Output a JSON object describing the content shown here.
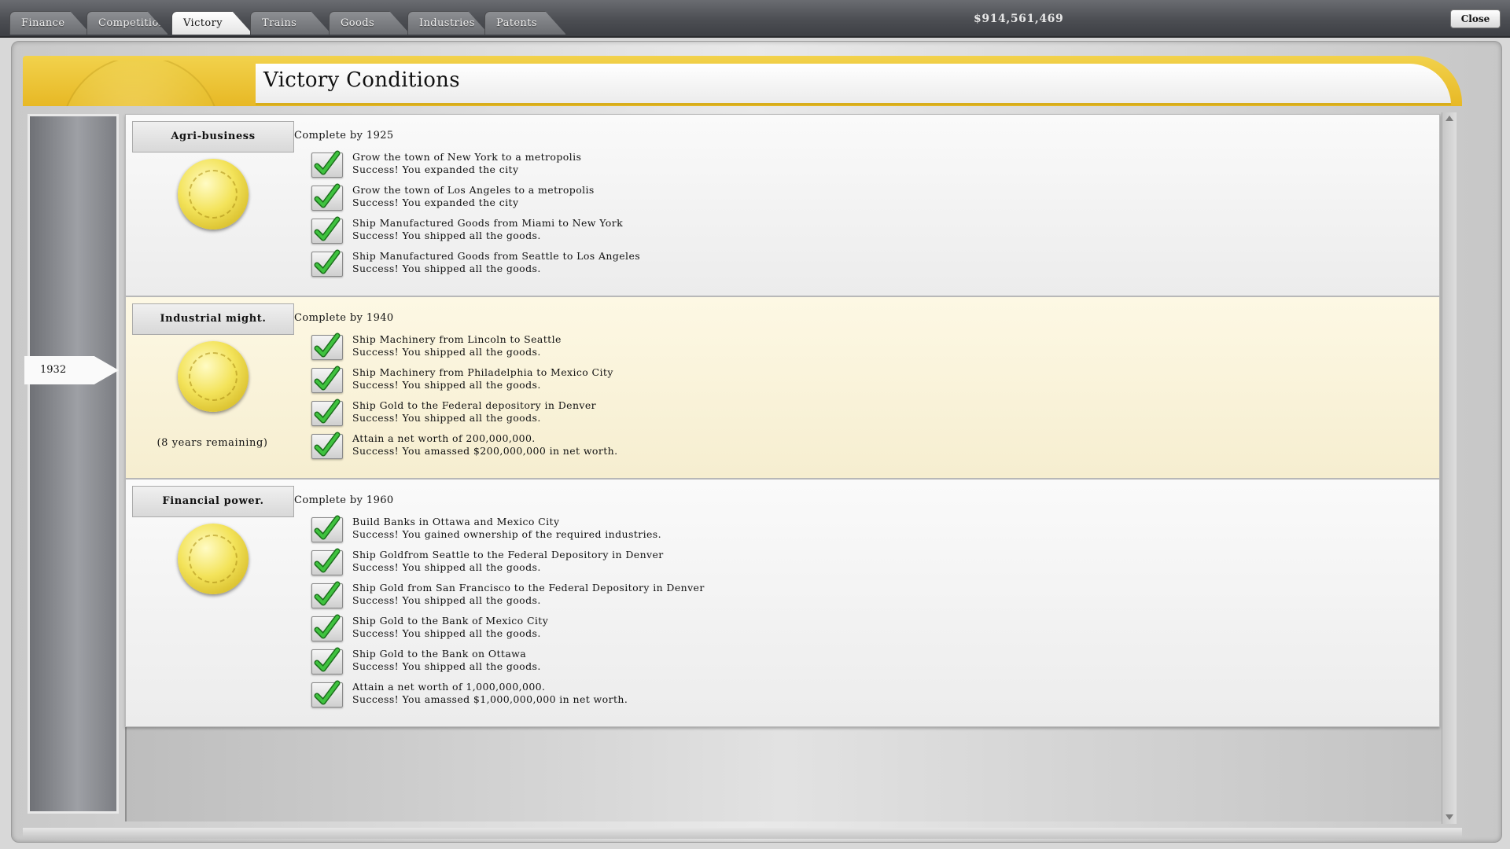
{
  "tabs": [
    {
      "label": "Finance",
      "active": false
    },
    {
      "label": "Competition",
      "active": false
    },
    {
      "label": "Victory",
      "active": true
    },
    {
      "label": "Trains",
      "active": false
    },
    {
      "label": "Goods",
      "active": false
    },
    {
      "label": "Industries",
      "active": false
    },
    {
      "label": "Patents",
      "active": false
    }
  ],
  "money": "$914,561,469",
  "close_label": "Close",
  "page_title": "Victory Conditions",
  "timeline": {
    "current_year": "1932"
  },
  "colors": {
    "accent_gold": "#e7b825",
    "check_green": "#2fae2f",
    "highlight": "#fdf8e4"
  },
  "sections": [
    {
      "name": "Agri-business",
      "complete_by": "Complete by 1925",
      "remaining": "",
      "highlight": false,
      "conditions": [
        {
          "goal": "Grow the town of New York to a metropolis",
          "status": "Success! You expanded the city",
          "done": true
        },
        {
          "goal": "Grow the town of Los Angeles to a metropolis",
          "status": "Success! You expanded the city",
          "done": true
        },
        {
          "goal": "Ship Manufactured Goods from Miami to New York",
          "status": "Success! You shipped all the goods.",
          "done": true
        },
        {
          "goal": "Ship Manufactured Goods from Seattle to Los Angeles",
          "status": "Success! You shipped all the goods.",
          "done": true
        }
      ]
    },
    {
      "name": "Industrial might.",
      "complete_by": "Complete by 1940",
      "remaining": "(8 years remaining)",
      "highlight": true,
      "conditions": [
        {
          "goal": "Ship Machinery from Lincoln to Seattle",
          "status": "Success! You shipped all the goods.",
          "done": true
        },
        {
          "goal": "Ship Machinery from Philadelphia to Mexico City",
          "status": "Success! You shipped all the goods.",
          "done": true
        },
        {
          "goal": "Ship Gold to the Federal depository in Denver",
          "status": "Success! You shipped all the goods.",
          "done": true
        },
        {
          "goal": "Attain a net worth of 200,000,000.",
          "status": "Success! You amassed $200,000,000 in net worth.",
          "done": true
        }
      ]
    },
    {
      "name": "Financial power.",
      "complete_by": "Complete by 1960",
      "remaining": "",
      "highlight": false,
      "conditions": [
        {
          "goal": "Build Banks in Ottawa and Mexico City",
          "status": "Success! You gained ownership of the required industries.",
          "done": true
        },
        {
          "goal": "Ship Goldfrom Seattle to the Federal Depository in Denver",
          "status": "Success! You shipped all the goods.",
          "done": true
        },
        {
          "goal": "Ship Gold from San Francisco to the Federal Depository in Denver",
          "status": "Success! You shipped all the goods.",
          "done": true
        },
        {
          "goal": "Ship Gold to the Bank of Mexico City",
          "status": "Success! You shipped all the goods.",
          "done": true
        },
        {
          "goal": "Ship Gold to the Bank on Ottawa",
          "status": "Success! You shipped all the goods.",
          "done": true
        },
        {
          "goal": "Attain a net worth of 1,000,000,000.",
          "status": "Success! You amassed $1,000,000,000 in net worth.",
          "done": true
        }
      ]
    }
  ]
}
